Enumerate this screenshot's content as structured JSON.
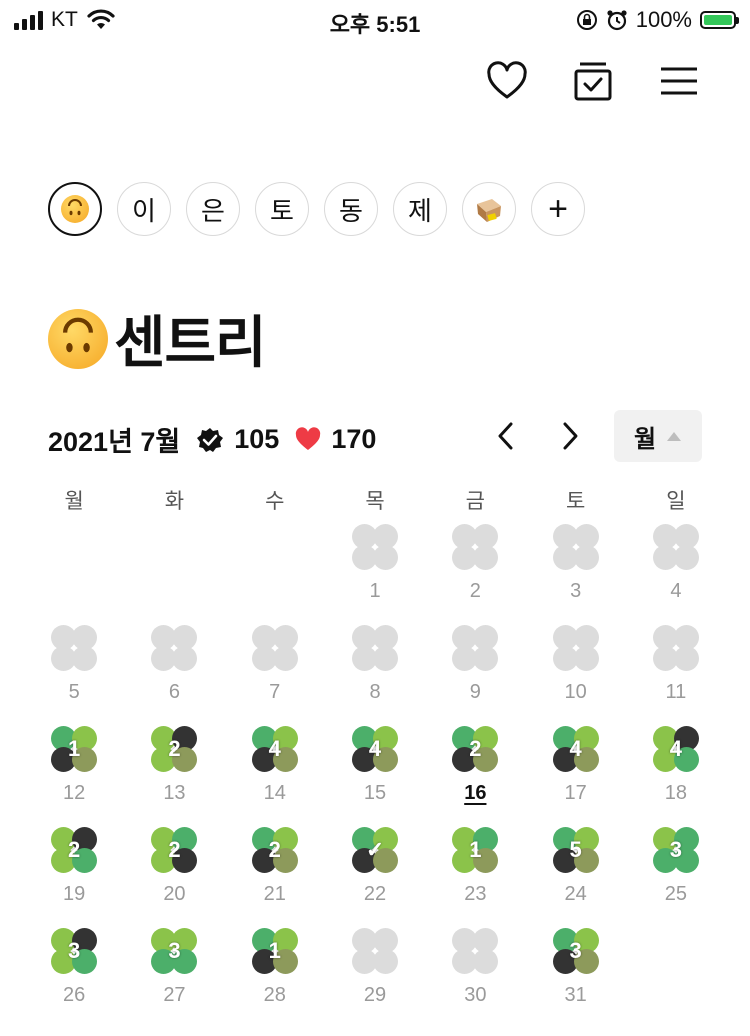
{
  "status_bar": {
    "carrier": "KT",
    "time": "오후 5:51",
    "battery": "100%"
  },
  "header": {
    "icons": [
      "heart-icon",
      "calendar-check-icon",
      "menu-icon"
    ]
  },
  "chips": [
    {
      "type": "emoji",
      "label": "",
      "active": true
    },
    {
      "type": "text",
      "label": "이"
    },
    {
      "type": "text",
      "label": "은"
    },
    {
      "type": "text",
      "label": "토"
    },
    {
      "type": "text",
      "label": "동"
    },
    {
      "type": "text",
      "label": "제"
    },
    {
      "type": "image",
      "label": ""
    },
    {
      "type": "add",
      "label": "+"
    }
  ],
  "title": "센트리",
  "stats": {
    "month": "2021년 7월",
    "checks": "105",
    "likes": "170"
  },
  "view_mode": "월",
  "weekdays": [
    "월",
    "화",
    "수",
    "목",
    "금",
    "토",
    "일"
  ],
  "colors": {
    "gray": "#dcdcdc",
    "dark": "#333333",
    "green": "#4caf6a",
    "lime": "#8bc34a",
    "olive": "#8d9a5b"
  },
  "days": [
    {
      "day": "",
      "empty": true
    },
    {
      "day": "",
      "empty": true
    },
    {
      "day": "",
      "empty": true
    },
    {
      "day": "1",
      "petals": [
        "gray",
        "gray",
        "gray",
        "gray"
      ],
      "count": ""
    },
    {
      "day": "2",
      "petals": [
        "gray",
        "gray",
        "gray",
        "gray"
      ],
      "count": ""
    },
    {
      "day": "3",
      "petals": [
        "gray",
        "gray",
        "gray",
        "gray"
      ],
      "count": ""
    },
    {
      "day": "4",
      "petals": [
        "gray",
        "gray",
        "gray",
        "gray"
      ],
      "count": ""
    },
    {
      "day": "5",
      "petals": [
        "gray",
        "gray",
        "gray",
        "gray"
      ],
      "count": ""
    },
    {
      "day": "6",
      "petals": [
        "gray",
        "gray",
        "gray",
        "gray"
      ],
      "count": ""
    },
    {
      "day": "7",
      "petals": [
        "gray",
        "gray",
        "gray",
        "gray"
      ],
      "count": ""
    },
    {
      "day": "8",
      "petals": [
        "gray",
        "gray",
        "gray",
        "gray"
      ],
      "count": ""
    },
    {
      "day": "9",
      "petals": [
        "gray",
        "gray",
        "gray",
        "gray"
      ],
      "count": ""
    },
    {
      "day": "10",
      "petals": [
        "gray",
        "gray",
        "gray",
        "gray"
      ],
      "count": ""
    },
    {
      "day": "11",
      "petals": [
        "gray",
        "gray",
        "gray",
        "gray"
      ],
      "count": ""
    },
    {
      "day": "12",
      "petals": [
        "green",
        "lime",
        "dark",
        "olive"
      ],
      "count": "1"
    },
    {
      "day": "13",
      "petals": [
        "lime",
        "dark",
        "lime",
        "olive"
      ],
      "count": "2"
    },
    {
      "day": "14",
      "petals": [
        "green",
        "lime",
        "dark",
        "olive"
      ],
      "count": "4"
    },
    {
      "day": "15",
      "petals": [
        "green",
        "lime",
        "dark",
        "olive"
      ],
      "count": "4"
    },
    {
      "day": "16",
      "petals": [
        "green",
        "lime",
        "dark",
        "olive"
      ],
      "count": "2",
      "today": true
    },
    {
      "day": "17",
      "petals": [
        "green",
        "lime",
        "dark",
        "olive"
      ],
      "count": "4"
    },
    {
      "day": "18",
      "petals": [
        "lime",
        "dark",
        "lime",
        "green"
      ],
      "count": "4"
    },
    {
      "day": "19",
      "petals": [
        "lime",
        "dark",
        "lime",
        "green"
      ],
      "count": "2"
    },
    {
      "day": "20",
      "petals": [
        "lime",
        "green",
        "lime",
        "dark"
      ],
      "count": "2"
    },
    {
      "day": "21",
      "petals": [
        "green",
        "lime",
        "dark",
        "olive"
      ],
      "count": "2"
    },
    {
      "day": "22",
      "petals": [
        "green",
        "lime",
        "dark",
        "olive"
      ],
      "count": "✓"
    },
    {
      "day": "23",
      "petals": [
        "lime",
        "green",
        "lime",
        "olive"
      ],
      "count": "1"
    },
    {
      "day": "24",
      "petals": [
        "green",
        "lime",
        "dark",
        "olive"
      ],
      "count": "5"
    },
    {
      "day": "25",
      "petals": [
        "lime",
        "green",
        "green",
        "green"
      ],
      "count": "3"
    },
    {
      "day": "26",
      "petals": [
        "lime",
        "dark",
        "lime",
        "green"
      ],
      "count": "3"
    },
    {
      "day": "27",
      "petals": [
        "lime",
        "lime",
        "green",
        "green"
      ],
      "count": "3"
    },
    {
      "day": "28",
      "petals": [
        "green",
        "lime",
        "dark",
        "olive"
      ],
      "count": "1"
    },
    {
      "day": "29",
      "petals": [
        "gray",
        "gray",
        "gray",
        "gray"
      ],
      "count": ""
    },
    {
      "day": "30",
      "petals": [
        "gray",
        "gray",
        "gray",
        "gray"
      ],
      "count": ""
    },
    {
      "day": "31",
      "petals": [
        "green",
        "lime",
        "dark",
        "olive"
      ],
      "count": "3"
    }
  ]
}
